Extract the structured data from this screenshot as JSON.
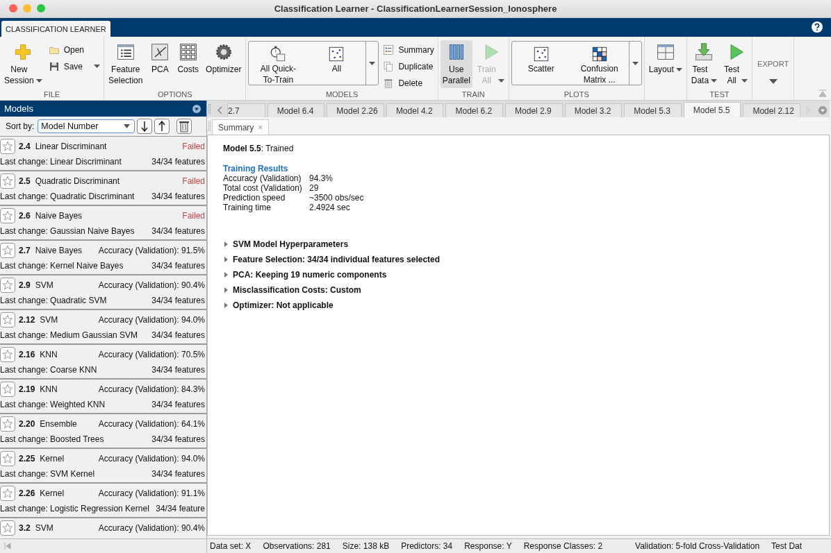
{
  "window": {
    "title": "Classification Learner - ClassificationLearnerSession_Ionosphere"
  },
  "ribbon_tabs": [
    {
      "label": "CLASSIFICATION LEARNER",
      "selected": true
    }
  ],
  "toolstrip": {
    "sections": [
      {
        "label": "FILE",
        "buttons": [
          {
            "kind": "large",
            "label": "New Session",
            "dropdown": true
          },
          {
            "kind": "stack",
            "items": [
              {
                "label": "Open"
              },
              {
                "label": "Save",
                "dropdown": true
              }
            ]
          }
        ]
      },
      {
        "label": "OPTIONS",
        "buttons": [
          {
            "kind": "large",
            "label": "Feature Selection"
          },
          {
            "kind": "large",
            "label": "PCA"
          },
          {
            "kind": "large",
            "label": "Costs"
          },
          {
            "kind": "large",
            "label": "Optimizer"
          }
        ]
      },
      {
        "label": "MODELS",
        "buttons": [
          {
            "kind": "gallery",
            "items": [
              {
                "label": "All Quick-To-Train"
              },
              {
                "label": "All"
              }
            ]
          },
          {
            "kind": "stack",
            "items": [
              {
                "label": "Summary"
              },
              {
                "label": "Duplicate"
              },
              {
                "label": "Delete"
              }
            ]
          }
        ]
      },
      {
        "label": "TRAIN",
        "buttons": [
          {
            "kind": "large",
            "label": "Use Parallel",
            "selected": true,
            "disabled": false
          },
          {
            "kind": "large",
            "label": "Train All",
            "dropdown": true,
            "selected": false,
            "disabled": true
          }
        ]
      },
      {
        "label": "PLOTS",
        "buttons": [
          {
            "kind": "gallery",
            "items": [
              {
                "label": "Scatter"
              },
              {
                "label": "Confusion Matrix ..."
              }
            ]
          }
        ]
      },
      {
        "buttons": [
          {
            "kind": "large",
            "label": "Layout",
            "dropdown": true
          }
        ]
      },
      {
        "label": "TEST",
        "buttons": [
          {
            "kind": "large",
            "label": "Test Data",
            "dropdown": true
          },
          {
            "kind": "large",
            "label": "Test All",
            "dropdown": true
          }
        ]
      },
      {
        "buttons": [
          {
            "kind": "menu",
            "label": "EXPORT"
          }
        ]
      }
    ]
  },
  "models_panel": {
    "title": "Models",
    "sort_label": "Sort by:",
    "sort_value": "Model Number",
    "models": [
      {
        "number": "2.4",
        "type": "Linear Discriminant",
        "status": "Failed",
        "failed": true,
        "starred": false,
        "last_change": "Last change: Linear Discriminant",
        "features": "34/34 features"
      },
      {
        "number": "2.5",
        "type": "Quadratic Discriminant",
        "status": "Failed",
        "failed": true,
        "starred": false,
        "last_change": "Last change: Quadratic Discriminant",
        "features": "34/34 features"
      },
      {
        "number": "2.6",
        "type": "Naive Bayes",
        "status": "Failed",
        "failed": true,
        "starred": false,
        "last_change": "Last change: Gaussian Naive Bayes",
        "features": "34/34 features"
      },
      {
        "number": "2.7",
        "type": "Naive Bayes",
        "status": "Accuracy (Validation): 91.5%",
        "failed": false,
        "starred": false,
        "last_change": "Last change: Kernel Naive Bayes",
        "features": "34/34 features"
      },
      {
        "number": "2.9",
        "type": "SVM",
        "status": "Accuracy (Validation): 90.4%",
        "failed": false,
        "starred": false,
        "last_change": "Last change: Quadratic SVM",
        "features": "34/34 features"
      },
      {
        "number": "2.12",
        "type": "SVM",
        "status": "Accuracy (Validation): 94.0%",
        "failed": false,
        "starred": false,
        "last_change": "Last change: Medium Gaussian SVM",
        "features": "34/34 features"
      },
      {
        "number": "2.16",
        "type": "KNN",
        "status": "Accuracy (Validation): 70.5%",
        "failed": false,
        "starred": false,
        "last_change": "Last change: Coarse KNN",
        "features": "34/34 features"
      },
      {
        "number": "2.19",
        "type": "KNN",
        "status": "Accuracy (Validation): 84.3%",
        "failed": false,
        "starred": false,
        "last_change": "Last change: Weighted KNN",
        "features": "34/34 features"
      },
      {
        "number": "2.20",
        "type": "Ensemble",
        "status": "Accuracy (Validation): 64.1%",
        "failed": false,
        "starred": false,
        "last_change": "Last change: Boosted Trees",
        "features": "34/34 features"
      },
      {
        "number": "2.25",
        "type": "Kernel",
        "status": "Accuracy (Validation): 94.0%",
        "failed": false,
        "starred": false,
        "last_change": "Last change: SVM Kernel",
        "features": "34/34 features"
      },
      {
        "number": "2.26",
        "type": "Kernel",
        "status": "Accuracy (Validation): 91.1%",
        "failed": false,
        "starred": false,
        "last_change": "Last change: Logistic Regression Kernel",
        "features": "34/34 feature"
      },
      {
        "number": "3.2",
        "type": "SVM",
        "status": "Accuracy (Validation): 90.4%",
        "failed": false,
        "starred": false
      }
    ]
  },
  "document_tabs": [
    {
      "label": "2.7",
      "selected": false
    },
    {
      "label": "Model 6.4",
      "selected": false
    },
    {
      "label": "Model 2.26",
      "selected": false
    },
    {
      "label": "Model 4.2",
      "selected": false
    },
    {
      "label": "Model 6.2",
      "selected": false
    },
    {
      "label": "Model 2.9",
      "selected": false
    },
    {
      "label": "Model 3.2",
      "selected": false
    },
    {
      "label": "Model 5.3",
      "selected": false
    },
    {
      "label": "Model 5.5",
      "selected": true
    },
    {
      "label": "Model 2.12",
      "selected": false
    }
  ],
  "summary": {
    "tab": "Summary",
    "close": "×",
    "heading": "**Model 5.5**: Trained",
    "results_title": "Training Results",
    "results": [
      {
        "label": "Accuracy (Validation)",
        "value": "94.3%"
      },
      {
        "label": "Total cost (Validation)",
        "value": "29"
      },
      {
        "label": "Prediction speed",
        "value": "~3500 obs/sec"
      },
      {
        "label": "Training time",
        "value": "2.4924 sec"
      }
    ],
    "sections": [
      {
        "label": "SVM Model Hyperparameters",
        "expanded": false
      },
      {
        "label": "Feature Selection: 34/34 individual features selected",
        "expanded": false
      },
      {
        "label": "PCA: Keeping 19 numeric components",
        "expanded": false
      },
      {
        "label": "Misclassification Costs: Custom",
        "expanded": false
      },
      {
        "label": "Optimizer: Not applicable",
        "expanded": false
      }
    ]
  },
  "status_bar": [
    "Data set: X",
    "Observations: 281",
    "Size: 138 kB",
    "Predictors: 34",
    "Response: Y",
    "Response Classes: 2",
    "Validation: 5-fold Cross-Validation",
    "Test Dat"
  ]
}
